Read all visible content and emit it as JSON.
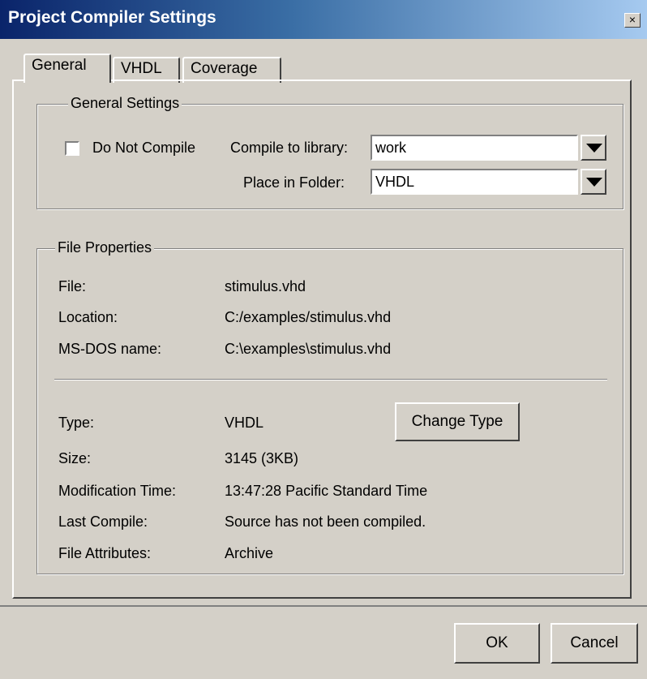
{
  "window": {
    "title": "Project Compiler Settings",
    "close_label": "×"
  },
  "tabs": [
    {
      "label": "General",
      "active": true
    },
    {
      "label": "VHDL",
      "active": false
    },
    {
      "label": "Coverage",
      "active": false
    }
  ],
  "general_settings": {
    "title": "General Settings",
    "do_not_compile": {
      "label": "Do Not Compile",
      "checked": false
    },
    "compile_to_library": {
      "label": "Compile to library:",
      "value": "work"
    },
    "place_in_folder": {
      "label": "Place in Folder:",
      "value": "VHDL"
    }
  },
  "file_properties": {
    "title": "File Properties",
    "file": {
      "label": "File:",
      "value": "stimulus.vhd"
    },
    "location": {
      "label": "Location:",
      "value": "C:/examples/stimulus.vhd"
    },
    "msdos_name": {
      "label": "MS-DOS name:",
      "value": "C:\\examples\\stimulus.vhd"
    },
    "type": {
      "label": "Type:",
      "value": "VHDL"
    },
    "change_type_label": "Change Type",
    "size": {
      "label": "Size:",
      "value": "3145 (3KB)"
    },
    "modification_time": {
      "label": "Modification Time:",
      "value": "13:47:28 Pacific Standard Time"
    },
    "last_compile": {
      "label": "Last Compile:",
      "value": "Source has not been compiled."
    },
    "file_attributes": {
      "label": "File Attributes:",
      "value": "Archive"
    }
  },
  "buttons": {
    "ok": "OK",
    "cancel": "Cancel"
  },
  "colors": {
    "face": "#d4d0c8",
    "title_start": "#0a246a",
    "title_end": "#a6caf0"
  }
}
